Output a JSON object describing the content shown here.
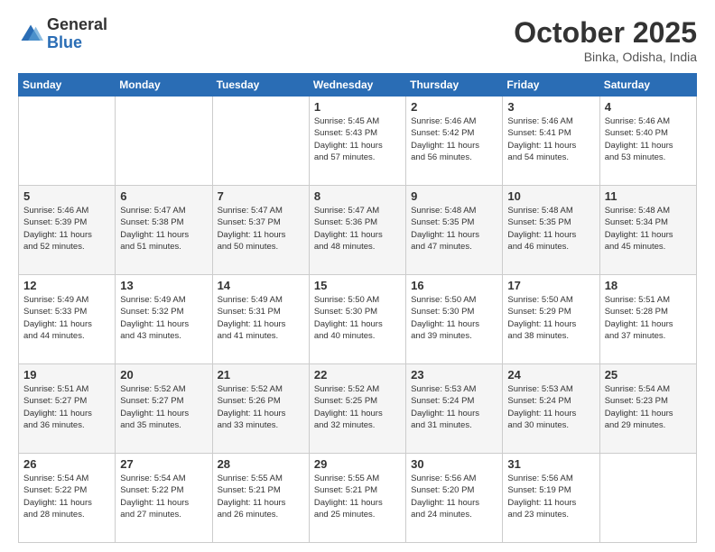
{
  "logo": {
    "general": "General",
    "blue": "Blue"
  },
  "header": {
    "month": "October 2025",
    "location": "Binka, Odisha, India"
  },
  "weekdays": [
    "Sunday",
    "Monday",
    "Tuesday",
    "Wednesday",
    "Thursday",
    "Friday",
    "Saturday"
  ],
  "weeks": [
    [
      {
        "day": "",
        "info": ""
      },
      {
        "day": "",
        "info": ""
      },
      {
        "day": "",
        "info": ""
      },
      {
        "day": "1",
        "info": "Sunrise: 5:45 AM\nSunset: 5:43 PM\nDaylight: 11 hours\nand 57 minutes."
      },
      {
        "day": "2",
        "info": "Sunrise: 5:46 AM\nSunset: 5:42 PM\nDaylight: 11 hours\nand 56 minutes."
      },
      {
        "day": "3",
        "info": "Sunrise: 5:46 AM\nSunset: 5:41 PM\nDaylight: 11 hours\nand 54 minutes."
      },
      {
        "day": "4",
        "info": "Sunrise: 5:46 AM\nSunset: 5:40 PM\nDaylight: 11 hours\nand 53 minutes."
      }
    ],
    [
      {
        "day": "5",
        "info": "Sunrise: 5:46 AM\nSunset: 5:39 PM\nDaylight: 11 hours\nand 52 minutes."
      },
      {
        "day": "6",
        "info": "Sunrise: 5:47 AM\nSunset: 5:38 PM\nDaylight: 11 hours\nand 51 minutes."
      },
      {
        "day": "7",
        "info": "Sunrise: 5:47 AM\nSunset: 5:37 PM\nDaylight: 11 hours\nand 50 minutes."
      },
      {
        "day": "8",
        "info": "Sunrise: 5:47 AM\nSunset: 5:36 PM\nDaylight: 11 hours\nand 48 minutes."
      },
      {
        "day": "9",
        "info": "Sunrise: 5:48 AM\nSunset: 5:35 PM\nDaylight: 11 hours\nand 47 minutes."
      },
      {
        "day": "10",
        "info": "Sunrise: 5:48 AM\nSunset: 5:35 PM\nDaylight: 11 hours\nand 46 minutes."
      },
      {
        "day": "11",
        "info": "Sunrise: 5:48 AM\nSunset: 5:34 PM\nDaylight: 11 hours\nand 45 minutes."
      }
    ],
    [
      {
        "day": "12",
        "info": "Sunrise: 5:49 AM\nSunset: 5:33 PM\nDaylight: 11 hours\nand 44 minutes."
      },
      {
        "day": "13",
        "info": "Sunrise: 5:49 AM\nSunset: 5:32 PM\nDaylight: 11 hours\nand 43 minutes."
      },
      {
        "day": "14",
        "info": "Sunrise: 5:49 AM\nSunset: 5:31 PM\nDaylight: 11 hours\nand 41 minutes."
      },
      {
        "day": "15",
        "info": "Sunrise: 5:50 AM\nSunset: 5:30 PM\nDaylight: 11 hours\nand 40 minutes."
      },
      {
        "day": "16",
        "info": "Sunrise: 5:50 AM\nSunset: 5:30 PM\nDaylight: 11 hours\nand 39 minutes."
      },
      {
        "day": "17",
        "info": "Sunrise: 5:50 AM\nSunset: 5:29 PM\nDaylight: 11 hours\nand 38 minutes."
      },
      {
        "day": "18",
        "info": "Sunrise: 5:51 AM\nSunset: 5:28 PM\nDaylight: 11 hours\nand 37 minutes."
      }
    ],
    [
      {
        "day": "19",
        "info": "Sunrise: 5:51 AM\nSunset: 5:27 PM\nDaylight: 11 hours\nand 36 minutes."
      },
      {
        "day": "20",
        "info": "Sunrise: 5:52 AM\nSunset: 5:27 PM\nDaylight: 11 hours\nand 35 minutes."
      },
      {
        "day": "21",
        "info": "Sunrise: 5:52 AM\nSunset: 5:26 PM\nDaylight: 11 hours\nand 33 minutes."
      },
      {
        "day": "22",
        "info": "Sunrise: 5:52 AM\nSunset: 5:25 PM\nDaylight: 11 hours\nand 32 minutes."
      },
      {
        "day": "23",
        "info": "Sunrise: 5:53 AM\nSunset: 5:24 PM\nDaylight: 11 hours\nand 31 minutes."
      },
      {
        "day": "24",
        "info": "Sunrise: 5:53 AM\nSunset: 5:24 PM\nDaylight: 11 hours\nand 30 minutes."
      },
      {
        "day": "25",
        "info": "Sunrise: 5:54 AM\nSunset: 5:23 PM\nDaylight: 11 hours\nand 29 minutes."
      }
    ],
    [
      {
        "day": "26",
        "info": "Sunrise: 5:54 AM\nSunset: 5:22 PM\nDaylight: 11 hours\nand 28 minutes."
      },
      {
        "day": "27",
        "info": "Sunrise: 5:54 AM\nSunset: 5:22 PM\nDaylight: 11 hours\nand 27 minutes."
      },
      {
        "day": "28",
        "info": "Sunrise: 5:55 AM\nSunset: 5:21 PM\nDaylight: 11 hours\nand 26 minutes."
      },
      {
        "day": "29",
        "info": "Sunrise: 5:55 AM\nSunset: 5:21 PM\nDaylight: 11 hours\nand 25 minutes."
      },
      {
        "day": "30",
        "info": "Sunrise: 5:56 AM\nSunset: 5:20 PM\nDaylight: 11 hours\nand 24 minutes."
      },
      {
        "day": "31",
        "info": "Sunrise: 5:56 AM\nSunset: 5:19 PM\nDaylight: 11 hours\nand 23 minutes."
      },
      {
        "day": "",
        "info": ""
      }
    ]
  ]
}
